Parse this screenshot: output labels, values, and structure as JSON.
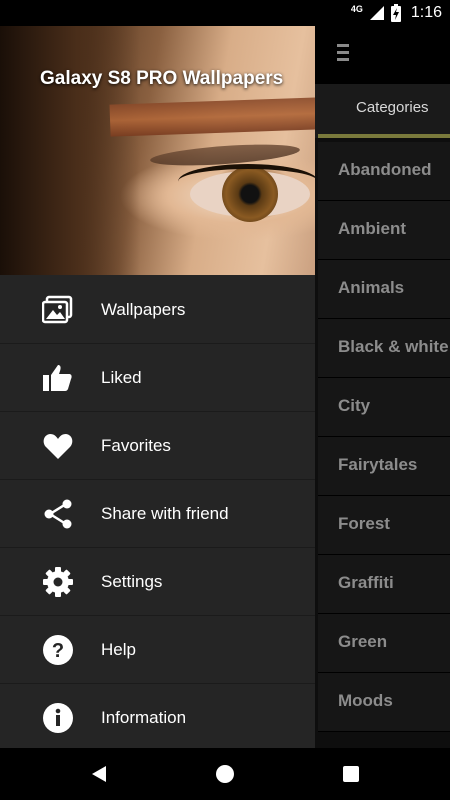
{
  "status_bar": {
    "network": "4G",
    "time": "1:16"
  },
  "drawer": {
    "title": "Galaxy S8 PRO Wallpapers",
    "items": [
      {
        "label": "Wallpapers",
        "icon": "images-icon"
      },
      {
        "label": "Liked",
        "icon": "thumbs-up-icon"
      },
      {
        "label": "Favorites",
        "icon": "heart-icon"
      },
      {
        "label": "Share with friend",
        "icon": "share-icon"
      },
      {
        "label": "Settings",
        "icon": "gear-icon"
      },
      {
        "label": "Help",
        "icon": "help-icon"
      },
      {
        "label": "Information",
        "icon": "info-icon"
      }
    ]
  },
  "background_app": {
    "header": "Categories",
    "categories": [
      "Abandoned",
      "Ambient",
      "Animals",
      "Black & white",
      "City",
      "Fairytales",
      "Forest",
      "Graffiti",
      "Green",
      "Moods"
    ]
  },
  "colors": {
    "drawer_bg": "#252525",
    "accent": "#7a7a3c",
    "category_text": "#8c8c8c"
  }
}
